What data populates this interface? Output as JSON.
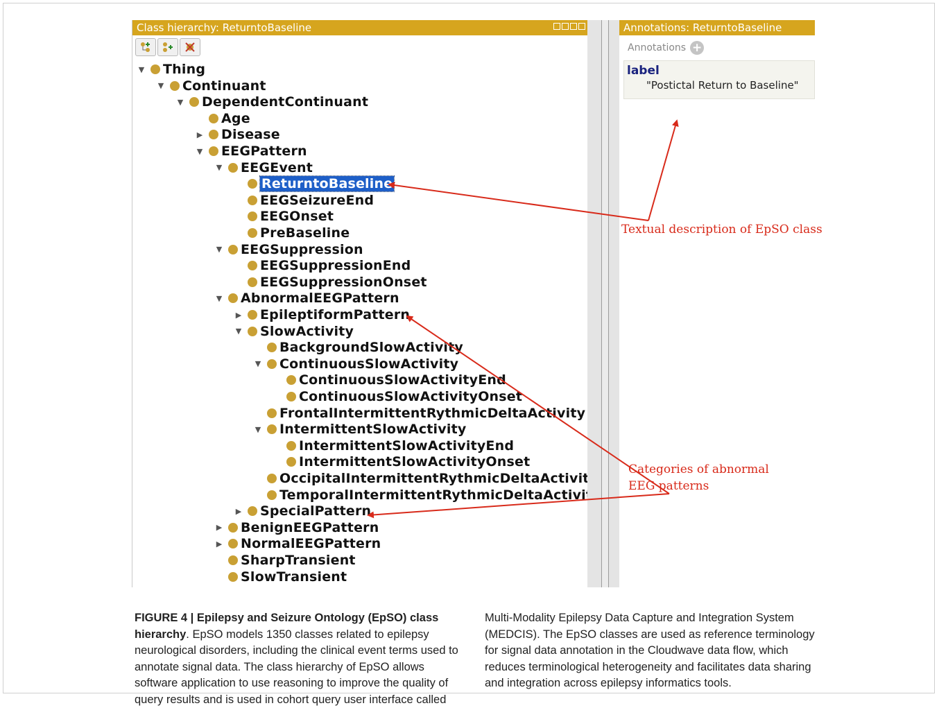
{
  "left_panel": {
    "title": "Class hierarchy: ReturntoBaseline",
    "toolbar_icons": [
      "add-subclass-icon",
      "add-sibling-class-icon",
      "delete-class-icon"
    ]
  },
  "tree": [
    {
      "label": "Thing",
      "depth": 0,
      "toggle": "expanded"
    },
    {
      "label": "Continuant",
      "depth": 1,
      "toggle": "expanded"
    },
    {
      "label": "DependentContinuant",
      "depth": 2,
      "toggle": "expanded"
    },
    {
      "label": "Age",
      "depth": 3,
      "toggle": "none"
    },
    {
      "label": "Disease",
      "depth": 3,
      "toggle": "collapsed"
    },
    {
      "label": "EEGPattern",
      "depth": 3,
      "toggle": "expanded"
    },
    {
      "label": "EEGEvent",
      "depth": 4,
      "toggle": "expanded"
    },
    {
      "label": "ReturntoBaseline",
      "depth": 5,
      "toggle": "none",
      "selected": true
    },
    {
      "label": "EEGSeizureEnd",
      "depth": 5,
      "toggle": "none"
    },
    {
      "label": "EEGOnset",
      "depth": 5,
      "toggle": "none"
    },
    {
      "label": "PreBaseline",
      "depth": 5,
      "toggle": "none"
    },
    {
      "label": "EEGSuppression",
      "depth": 4,
      "toggle": "expanded"
    },
    {
      "label": "EEGSuppressionEnd",
      "depth": 5,
      "toggle": "none"
    },
    {
      "label": "EEGSuppressionOnset",
      "depth": 5,
      "toggle": "none"
    },
    {
      "label": "AbnormalEEGPattern",
      "depth": 4,
      "toggle": "expanded"
    },
    {
      "label": "EpileptiformPattern",
      "depth": 5,
      "toggle": "collapsed"
    },
    {
      "label": "SlowActivity",
      "depth": 5,
      "toggle": "expanded"
    },
    {
      "label": "BackgroundSlowActivity",
      "depth": 6,
      "toggle": "none"
    },
    {
      "label": "ContinuousSlowActivity",
      "depth": 6,
      "toggle": "expanded"
    },
    {
      "label": "ContinuousSlowActivityEnd",
      "depth": 7,
      "toggle": "none"
    },
    {
      "label": "ContinuousSlowActivityOnset",
      "depth": 7,
      "toggle": "none"
    },
    {
      "label": "FrontalIntermittentRythmicDeltaActivity",
      "depth": 6,
      "toggle": "none"
    },
    {
      "label": "IntermittentSlowActivity",
      "depth": 6,
      "toggle": "expanded"
    },
    {
      "label": "IntermittentSlowActivityEnd",
      "depth": 7,
      "toggle": "none"
    },
    {
      "label": "IntermittentSlowActivityOnset",
      "depth": 7,
      "toggle": "none"
    },
    {
      "label": "OccipitalIntermittentRythmicDeltaActivity",
      "depth": 6,
      "toggle": "none"
    },
    {
      "label": "TemporalIntermittentRythmicDeltaActivity",
      "depth": 6,
      "toggle": "none"
    },
    {
      "label": "SpecialPattern",
      "depth": 5,
      "toggle": "collapsed"
    },
    {
      "label": "BenignEEGPattern",
      "depth": 4,
      "toggle": "collapsed"
    },
    {
      "label": "NormalEEGPattern",
      "depth": 4,
      "toggle": "collapsed"
    },
    {
      "label": "SharpTransient",
      "depth": 4,
      "toggle": "none"
    },
    {
      "label": "SlowTransient",
      "depth": 4,
      "toggle": "none"
    }
  ],
  "right_panel": {
    "title": "Annotations: ReturntoBaseline",
    "section_label": "Annotations",
    "annotation_key": "label",
    "annotation_value": "\"Postictal Return to Baseline\""
  },
  "callouts": {
    "textual_description": "Textual description of EpSO class",
    "categories_line1": "Categories of abnormal",
    "categories_line2": "EEG patterns"
  },
  "caption": {
    "title": "FIGURE 4 | Epilepsy and Seizure Ontology (EpSO) class hierarchy",
    "title_suffix": ".",
    "left_text": "EpSO models 1350 classes related to epilepsy neurological disorders, including the clinical event terms used to annotate signal data. The class hierarchy of EpSO allows software application to use reasoning to improve the quality of query results and is used in cohort query user interface called",
    "right_text": "Multi-Modality Epilepsy Data Capture and Integration System (MEDCIS). The EpSO classes are used as reference terminology for signal data annotation in the Cloudwave data flow, which reduces terminological heterogeneity and facilitates data sharing and integration across epilepsy informatics tools."
  },
  "colors": {
    "title_bar": "#d6a51e",
    "class_dot": "#c9a034",
    "selection": "#1e5fc8",
    "callout": "#d82a1a"
  }
}
